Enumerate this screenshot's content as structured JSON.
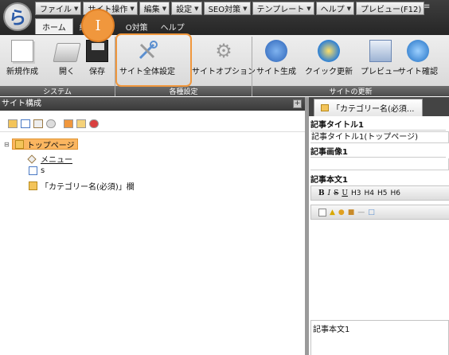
{
  "app": {
    "logo_glyph": "ら",
    "menu_end_glyph": "≡"
  },
  "menubar": [
    {
      "label": "ファイル"
    },
    {
      "label": "サイト操作"
    },
    {
      "label": "編集"
    },
    {
      "label": "設定"
    },
    {
      "label": "SEO対策"
    },
    {
      "label": "テンプレート"
    },
    {
      "label": "ヘルプ"
    },
    {
      "label": "プレビュー(F12)"
    }
  ],
  "tabs": [
    {
      "label": "ホーム",
      "active": true
    },
    {
      "label": "編"
    },
    {
      "label": "O対策"
    },
    {
      "label": "ヘルプ"
    }
  ],
  "ribbon": {
    "groups": {
      "system": "システム",
      "settings": "各種設定",
      "update": "サイトの更新"
    },
    "buttons": {
      "new": "新規作成",
      "open": "開く",
      "save": "保存",
      "site_settings": "サイト全体設定",
      "site_options": "サイトオプション",
      "site_generate": "サイト生成",
      "quick_update": "クイック更新",
      "preview": "プレビュー",
      "site_check": "サイト確認"
    }
  },
  "callout": {
    "label": "I",
    "color": "#f0973d"
  },
  "site_panel": {
    "title": "サイト構成",
    "collapse_glyph": "+",
    "tree": [
      {
        "label": "トップページ",
        "selected": true
      },
      {
        "label": "メニュー"
      },
      {
        "label": "s"
      },
      {
        "label": "「カテゴリー名(必須)」欄"
      }
    ]
  },
  "editor_panel": {
    "tab_label": "「カテゴリー名(必須...",
    "fields": {
      "title_label": "記事タイトル1",
      "title_value": "記事タイトル1(トップページ)",
      "image_label": "記事画像1",
      "body_label": "記事本文1",
      "body_value": "記事本文1"
    },
    "format_buttons": [
      "B",
      "I",
      "S",
      "U",
      "H3",
      "H4",
      "H5",
      "H6"
    ]
  },
  "colors": {
    "accent_orange": "#f0973d",
    "ribbon_label_bg": "#4c4c4c",
    "topbar_bg": "#2b2b2b"
  }
}
